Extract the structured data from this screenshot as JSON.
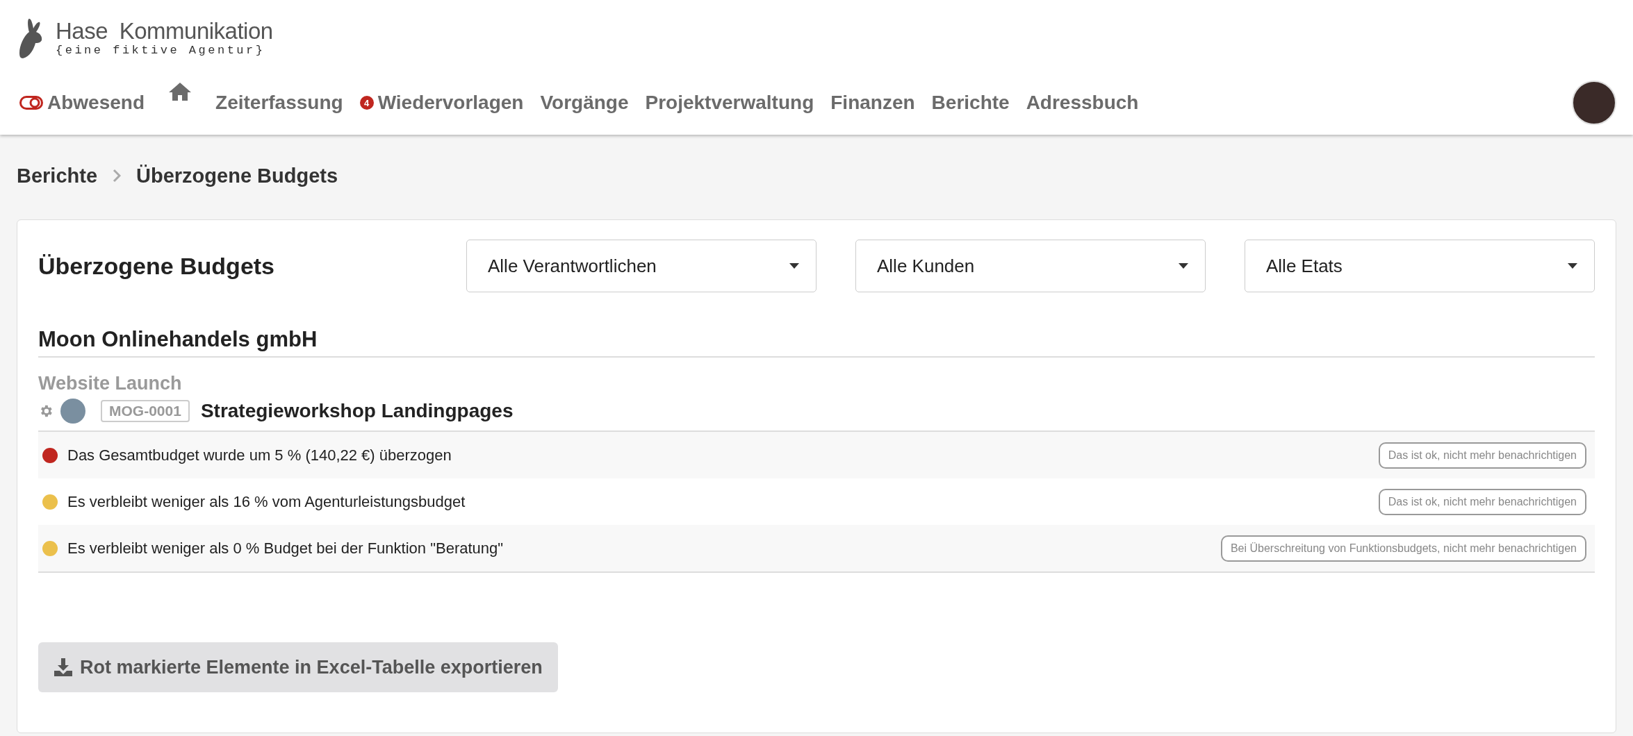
{
  "logo": {
    "name": "Hase Kommunikation",
    "tagline": "{eine fiktive Agentur}"
  },
  "nav": [
    {
      "kind": "status",
      "label": "Abwesend"
    },
    {
      "kind": "home"
    },
    {
      "kind": "link",
      "label": "Zeiterfassung"
    },
    {
      "kind": "badge",
      "label": "Wiedervorlagen",
      "badge": "4"
    },
    {
      "kind": "link",
      "label": "Vorgänge"
    },
    {
      "kind": "link",
      "label": "Projektverwaltung"
    },
    {
      "kind": "link",
      "label": "Finanzen"
    },
    {
      "kind": "link",
      "label": "Berichte"
    },
    {
      "kind": "link",
      "label": "Adressbuch"
    }
  ],
  "breadcrumb": [
    "Berichte",
    "Überzogene Budgets"
  ],
  "report": {
    "title": "Überzogene Budgets",
    "filters": [
      "Alle Verantwortlichen",
      "Alle Kunden",
      "Alle Etats"
    ],
    "client": "Moon Onlinehandels gmbH",
    "budget": "Website Launch",
    "project": {
      "code": "MOG-0001",
      "name": "Strategieworkshop Landingpages"
    },
    "alerts": [
      {
        "color": "#c0261f",
        "text": "Das Gesamtbudget wurde um 5 % (140,22 €) überzogen",
        "action": "Das ist ok, nicht mehr benachrichtigen"
      },
      {
        "color": "#ebc04c",
        "text": "Es verbleibt weniger als 16 % vom Agenturleistungsbudget",
        "action": "Das ist ok, nicht mehr benachrichtigen"
      },
      {
        "color": "#ebc04c",
        "text": "Es verbleibt weniger als 0 % Budget bei der Funktion \"Beratung\"",
        "action": "Bei Überschreitung von Funktionsbudgets, nicht mehr benachrichtigen"
      }
    ],
    "export": "Rot markierte Elemente in Excel-Tabelle exportieren"
  }
}
